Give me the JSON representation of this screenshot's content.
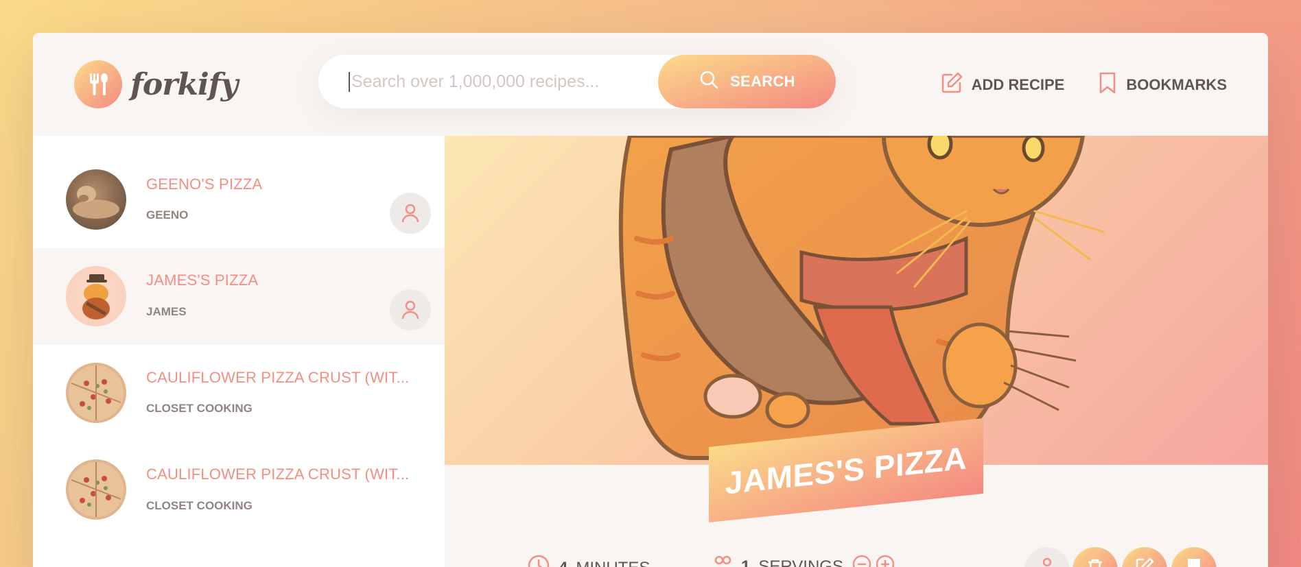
{
  "app": {
    "logo_text": "forkify",
    "logo_icon": "fork-spoon-icon"
  },
  "search": {
    "placeholder": "Search over 1,000,000 recipes...",
    "value": "",
    "button_label": "SEARCH",
    "button_icon": "search-icon"
  },
  "nav": {
    "add_recipe_label": "ADD RECIPE",
    "add_recipe_icon": "edit-icon",
    "bookmarks_label": "BOOKMARKS",
    "bookmarks_icon": "bookmark-icon"
  },
  "results": [
    {
      "title": "GEENO'S PIZZA",
      "publisher": "GEENO",
      "user_generated": true,
      "active": false
    },
    {
      "title": "JAMES'S PIZZA",
      "publisher": "JAMES",
      "user_generated": true,
      "active": true
    },
    {
      "title": "CAULIFLOWER PIZZA CRUST (WIT...",
      "publisher": "CLOSET COOKING",
      "user_generated": false,
      "active": false
    },
    {
      "title": "CAULIFLOWER PIZZA CRUST (WIT...",
      "publisher": "CLOSET COOKING",
      "user_generated": false,
      "active": false
    }
  ],
  "recipe": {
    "title": "JAMES'S PIZZA",
    "cooking_time": "4",
    "cooking_time_unit": "MINUTES",
    "servings": "1",
    "servings_unit": "SERVINGS"
  },
  "colors": {
    "accent_start": "#fbdb89",
    "accent_end": "#f48982",
    "text": "#615551",
    "title": "#f38e82"
  }
}
